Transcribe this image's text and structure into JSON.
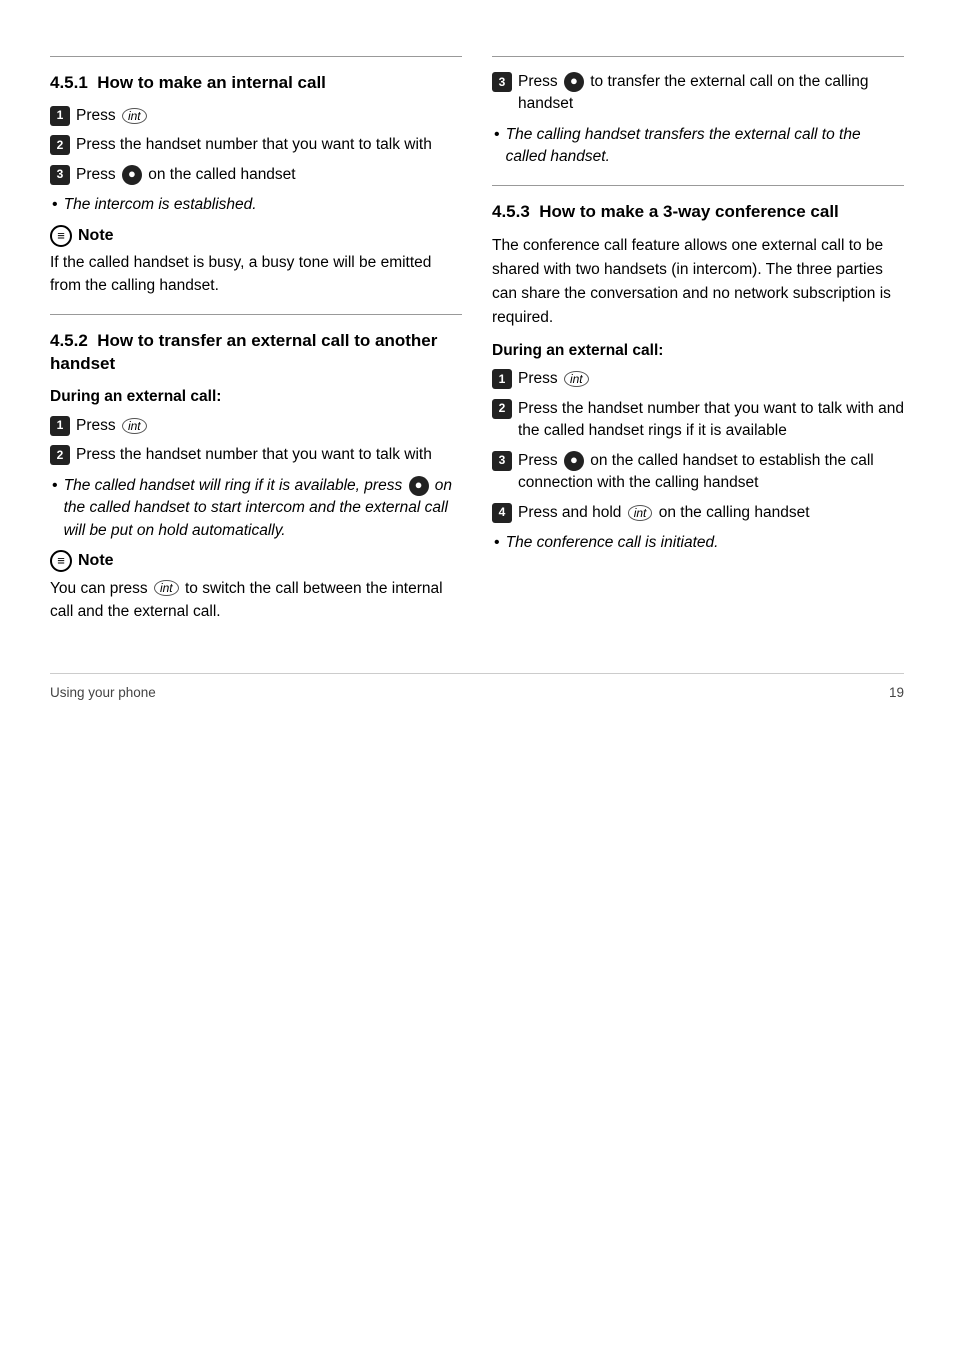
{
  "page": {
    "footer_left": "Using your phone",
    "footer_right": "19"
  },
  "left": {
    "section451": {
      "number": "4.5.1",
      "title": "How to make an internal call",
      "steps": [
        {
          "num": "1",
          "text_before": "Press",
          "badge": "int",
          "text_after": ""
        },
        {
          "num": "2",
          "text": "Press the handset number that you want to talk with"
        },
        {
          "num": "3",
          "text_before": "Press",
          "btn": true,
          "text_after": "on the called handset"
        }
      ],
      "bullet": "The intercom is established.",
      "note_header": "Note",
      "note_body": "If the called handset is busy, a busy tone will be emitted from the calling handset."
    },
    "section452": {
      "number": "4.5.2",
      "title": "How to transfer an external call to another handset",
      "during_label": "During an external call:",
      "steps": [
        {
          "num": "1",
          "text_before": "Press",
          "badge": "int",
          "text_after": ""
        },
        {
          "num": "2",
          "text": "Press the handset number that you want to talk with"
        }
      ],
      "bullet": "The called handset will ring if it is available, press",
      "bullet_btn": true,
      "bullet_rest": "on the called handset to start intercom and the external call will be put on hold automatically.",
      "note_header": "Note",
      "note_body_prefix": "You can press",
      "note_badge": "int",
      "note_body_suffix": "to switch the call between the internal call and the external call."
    }
  },
  "right": {
    "section452_continued": {
      "steps": [
        {
          "num": "3",
          "text_before": "Press",
          "btn": true,
          "text_after": "to transfer the external call on the calling handset"
        }
      ],
      "bullet": "The calling handset transfers the external call to the called handset."
    },
    "section453": {
      "number": "4.5.3",
      "title": "How to make a 3-way conference call",
      "body": "The conference call feature allows one external call to be shared with two handsets (in intercom). The three parties can share the conversation and no network subscription is required.",
      "during_label": "During an external call:",
      "steps": [
        {
          "num": "1",
          "text_before": "Press",
          "badge": "int",
          "text_after": ""
        },
        {
          "num": "2",
          "text": "Press the handset number that you want to talk with and the called handset rings if it is available"
        },
        {
          "num": "3",
          "text_before": "Press",
          "btn": true,
          "text_after": "on the called handset to establish the call connection with the calling handset"
        },
        {
          "num": "4",
          "text_before": "Press and hold",
          "badge": "int",
          "text_after": "on the calling handset"
        }
      ],
      "bullet": "The conference call is initiated."
    }
  }
}
